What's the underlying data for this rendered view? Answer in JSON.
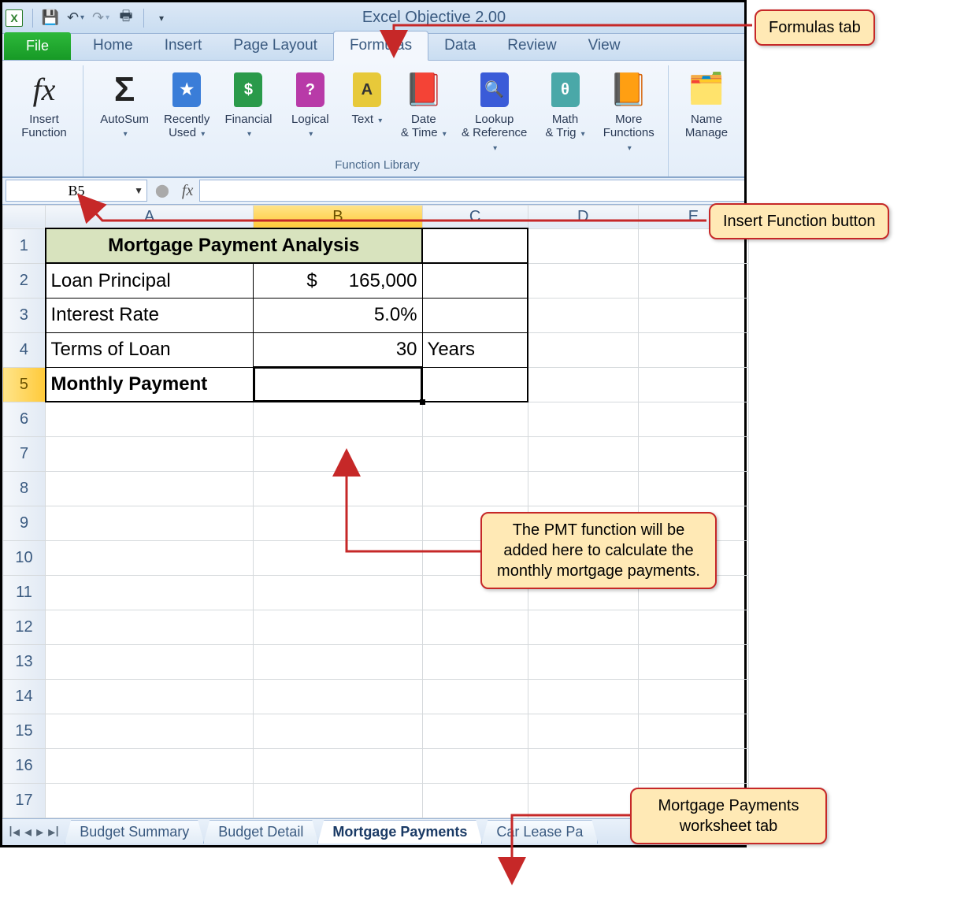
{
  "title": "Excel Objective 2.00",
  "qat": {
    "save": "💾",
    "undo": "↶",
    "redo": "↷",
    "print": "🖶"
  },
  "tabs": {
    "file": "File",
    "items": [
      "Home",
      "Insert",
      "Page Layout",
      "Formulas",
      "Data",
      "Review",
      "View"
    ],
    "active_index": 3
  },
  "ribbon": {
    "insert_function": "Insert\nFunction",
    "group_label": "Function Library",
    "buttons": [
      {
        "label": "AutoSum",
        "dd": true,
        "glyph": "Σ",
        "bg": "#222",
        "fg": "#222",
        "plain": true
      },
      {
        "label": "Recently Used",
        "dd": true,
        "glyph": "★",
        "bg": "#3a7dd8"
      },
      {
        "label": "Financial",
        "dd": true,
        "glyph": "$",
        "bg": "#2a9a4a"
      },
      {
        "label": "Logical",
        "dd": true,
        "glyph": "?",
        "bg": "#b83aa8"
      },
      {
        "label": "Text",
        "dd": true,
        "glyph": "A",
        "bg": "#e7c93a",
        "fg": "#333"
      },
      {
        "label": "Date & Time",
        "dd": true,
        "glyph": "📕",
        "bg": "",
        "raw": true
      },
      {
        "label": "Lookup & Reference",
        "dd": true,
        "glyph": "🔍",
        "bg": "#3a5bd8"
      },
      {
        "label": "Math & Trig",
        "dd": true,
        "glyph": "θ",
        "bg": "#4aa8a8"
      },
      {
        "label": "More Functions",
        "dd": true,
        "glyph": "📙",
        "bg": "",
        "raw": true
      }
    ],
    "name_manager": "Name\nManage"
  },
  "namebox": "B5",
  "formula": "",
  "columns": [
    "A",
    "B",
    "C",
    "D",
    "E"
  ],
  "selected_col_index": 1,
  "rows_count": 17,
  "selected_row": 5,
  "sheet": {
    "title": "Mortgage Payment Analysis",
    "rows": [
      {
        "label": "Loan Principal",
        "value": "$      165,000",
        "extra": ""
      },
      {
        "label": "Interest Rate",
        "value": "5.0%",
        "extra": ""
      },
      {
        "label": "Terms of Loan",
        "value": "30",
        "extra": "Years"
      },
      {
        "label": "Monthly Payment",
        "value": "",
        "extra": "",
        "bold": true
      }
    ]
  },
  "sheet_tabs": {
    "items": [
      "Budget Summary",
      "Budget Detail",
      "Mortgage Payments",
      "Car Lease Pa"
    ],
    "active_index": 2
  },
  "callouts": {
    "formulas_tab": "Formulas tab",
    "insert_fn": "Insert Function button",
    "pmt": "The PMT function will be added here to calculate the monthly mortgage payments.",
    "ws_tab": "Mortgage Payments worksheet tab"
  }
}
